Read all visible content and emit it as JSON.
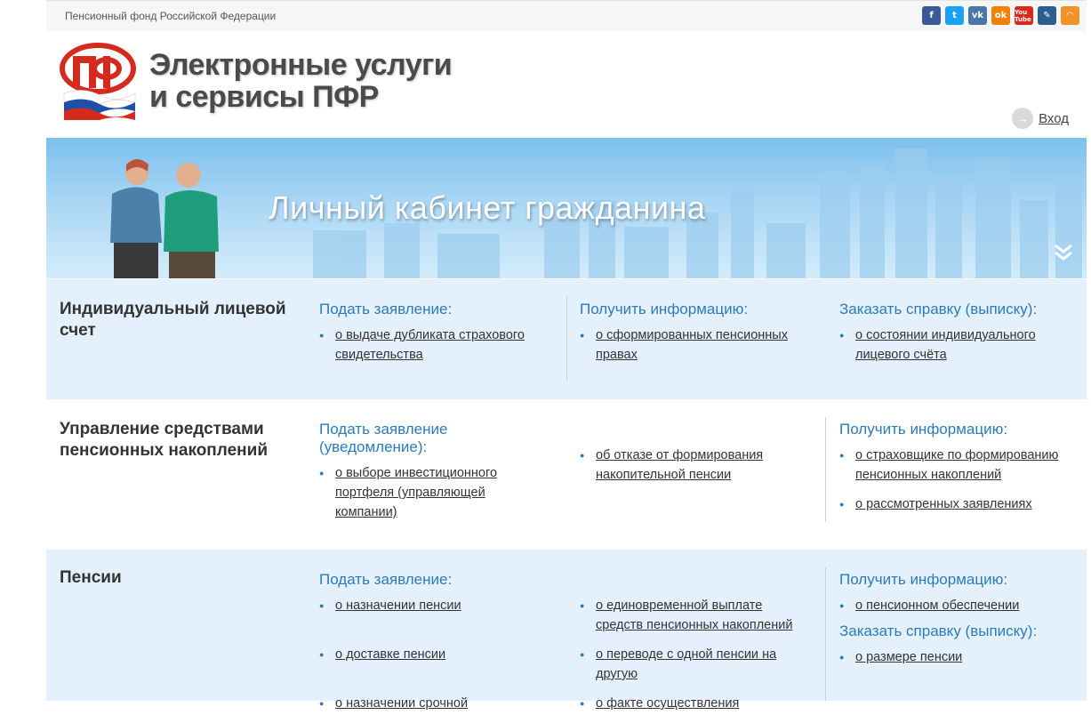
{
  "topbar": {
    "org_name": "Пенсионный фонд Российской Федерации"
  },
  "social": [
    "facebook-icon",
    "twitter-icon",
    "vk-icon",
    "odnoklassniki-icon",
    "youtube-icon",
    "livejournal-icon",
    "rss-icon"
  ],
  "header": {
    "title_line1": "Электронные услуги",
    "title_line2": "и сервисы ПФР",
    "login_label": "Вход"
  },
  "banner": {
    "title": "Личный кабинет гражданина"
  },
  "sections": {
    "ils": {
      "title": "Индивидуальный лицевой счет",
      "col1": {
        "heading": "Подать заявление:",
        "items": [
          "о выдаче дубликата страхового свидетельства"
        ]
      },
      "col2": {
        "heading": "Получить информацию:",
        "items": [
          "о сформированных пенсионных правах"
        ]
      },
      "col3": {
        "heading": "Заказать справку (выписку):",
        "items": [
          "о состоянии индивидуального лицевого счёта"
        ]
      }
    },
    "savings": {
      "title": "Управление средствами пенсионных накоплений",
      "col1": {
        "heading": "Подать заявление (уведомление):",
        "items": [
          "о выборе инвестиционного портфеля (управляющей компании)"
        ]
      },
      "col2": {
        "items": [
          "об отказе от формирования накопительной пенсии"
        ]
      },
      "col3": {
        "heading": "Получить информацию:",
        "items": [
          "о страховщике по формированию пенсионных накоплений",
          "о рассмотренных заявлениях"
        ]
      }
    },
    "pensions": {
      "title": "Пенсии",
      "col1": {
        "heading": "Подать заявление:",
        "items": [
          "о назначении пенсии",
          "о доставке пенсии",
          "о назначении срочной"
        ]
      },
      "col2": {
        "items": [
          "о единовременной выплате средств пенсионных накоплений",
          "о переводе с одной пенсии на другую",
          "о факте осуществления"
        ]
      },
      "col3": {
        "heading": "Получить информацию:",
        "items": [
          "о пенсионном обеспечении"
        ],
        "heading2": "Заказать справку (выписку):",
        "items2": [
          "о размере пенсии"
        ]
      }
    }
  },
  "colors": {
    "accent": "#2a7bbd",
    "section_bg": "#e4f1fc",
    "logo_red": "#d52b1e"
  }
}
